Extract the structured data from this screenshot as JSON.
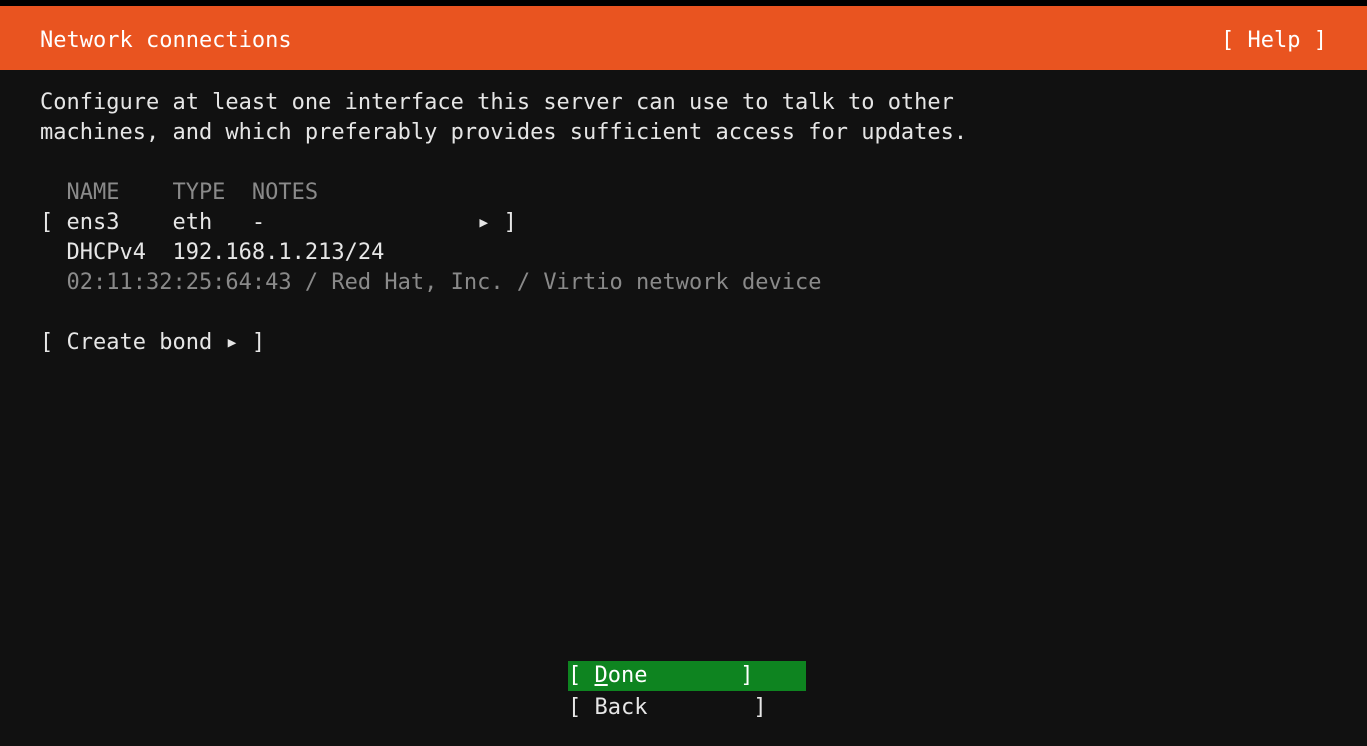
{
  "header": {
    "title": "Network connections",
    "help_button": "[ Help ]"
  },
  "intro": {
    "line1": "Configure at least one interface this server can use to talk to other",
    "line2": "machines, and which preferably provides sufficient access for updates."
  },
  "interfaces_table": {
    "columns": [
      "NAME",
      "TYPE",
      "NOTES"
    ],
    "columns_line": "  NAME    TYPE  NOTES",
    "rows": [
      {
        "name": "ens3",
        "type": "eth",
        "notes": "-",
        "row_text": "[ ens3    eth   -                ▸ ]",
        "address_text": "  DHCPv4  192.168.1.213/24",
        "device_text": "  02:11:32:25:64:43 / Red Hat, Inc. / Virtio network device"
      }
    ]
  },
  "create_bond_button": "[ Create bond ▸ ]",
  "buttons": {
    "done": {
      "open": "[ ",
      "label_first": "D",
      "label_rest": "one",
      "close": "       ]"
    },
    "back": "[ Back        ]"
  },
  "colors": {
    "header_bg": "#e95420",
    "focused_button_bg": "#0e8420",
    "background": "#111111",
    "text": "#e6e6e6",
    "dim_text": "#8a8a8a"
  }
}
